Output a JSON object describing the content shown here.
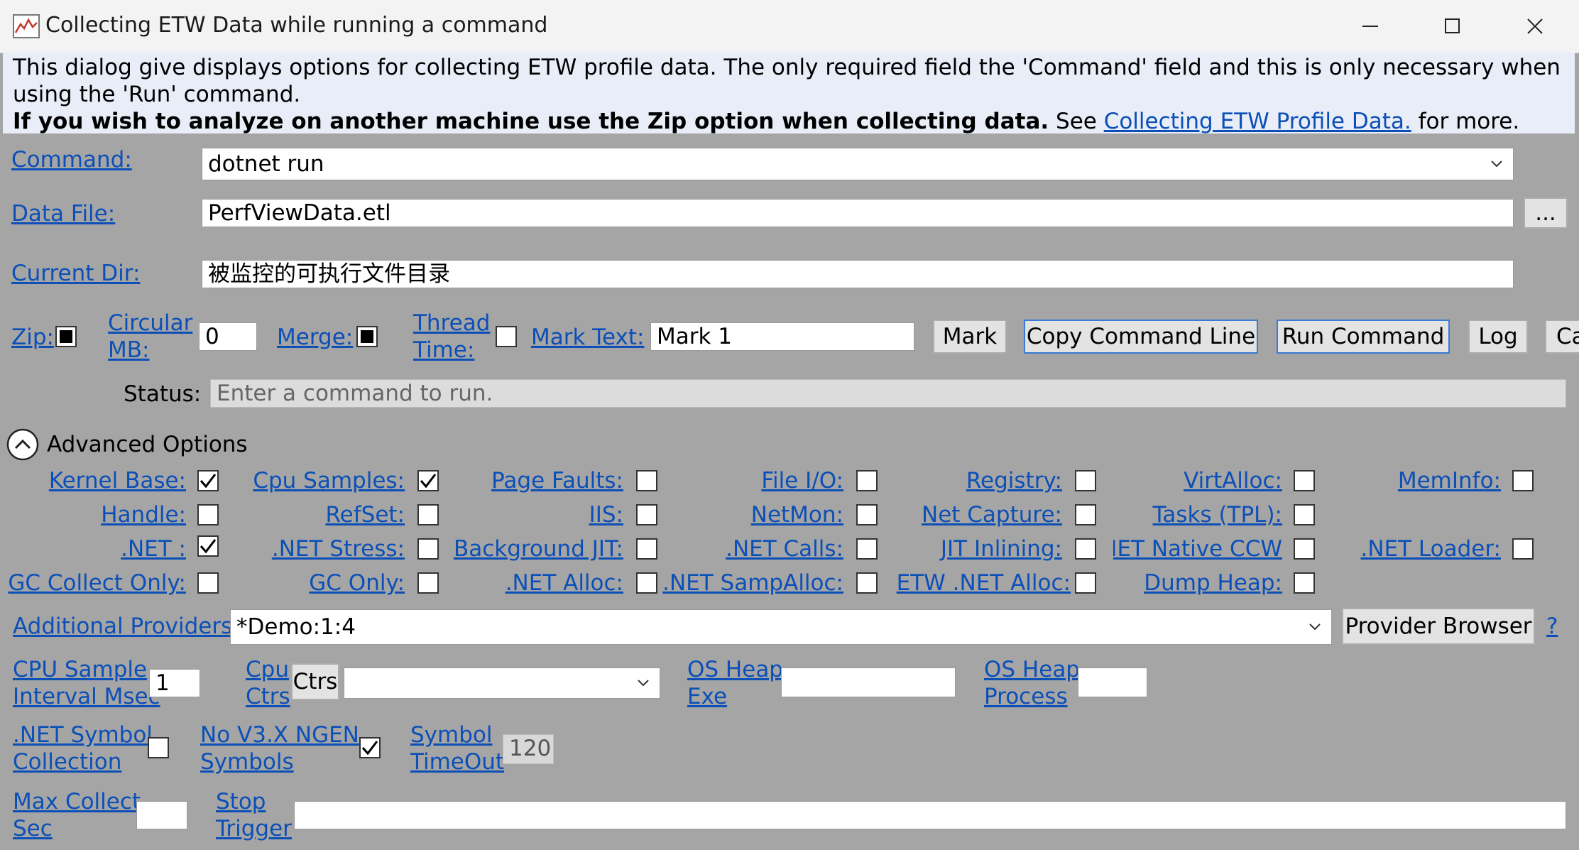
{
  "window": {
    "title": "Collecting ETW Data while running a command",
    "minimize_icon": "minimize-icon",
    "maximize_icon": "maximize-icon",
    "close_icon": "close-icon"
  },
  "info": {
    "line1": "This dialog give displays options for collecting ETW profile data. The only required field the 'Command' field and this is only necessary when using the 'Run' command.",
    "bold": "If you wish to analyze on another machine use the Zip option when collecting data.",
    "see": " See ",
    "link": "Collecting ETW Profile Data.",
    "more": " for more."
  },
  "command": {
    "label": "Command:",
    "value": "dotnet run"
  },
  "data_file": {
    "label": "Data File:",
    "value": "PerfViewData.etl",
    "browse": "..."
  },
  "current_dir": {
    "label": "Current Dir:",
    "value": "被监控的可执行文件目录"
  },
  "options_row": {
    "zip": "Zip:",
    "circular_1": "Circular",
    "circular_2": "MB:",
    "circular_value": "0",
    "merge": "Merge:",
    "thread_1": "Thread",
    "thread_2": "Time:",
    "mark_text": "Mark Text:",
    "mark_value": "Mark 1",
    "mark_btn": "Mark",
    "copy_btn": "Copy Command Line",
    "run_btn": "Run Command",
    "log_btn": "Log",
    "cancel_btn": "Ca"
  },
  "status": {
    "label": "Status:",
    "value": "Enter a command to run."
  },
  "advanced": {
    "label": "Advanced Options"
  },
  "grid": {
    "col1": [
      "Kernel Base:",
      "Handle:",
      ".NET :",
      "GC Collect Only:"
    ],
    "col2": [
      "Cpu Samples:",
      "RefSet:",
      ".NET Stress:",
      "GC Only:"
    ],
    "col3": [
      "Page Faults:",
      "IIS:",
      "Background JIT:",
      ".NET Alloc:"
    ],
    "col4": [
      "File I/O:",
      "NetMon:",
      ".NET Calls:",
      ".NET SampAlloc:"
    ],
    "col5": [
      "Registry:",
      "Net Capture:",
      "JIT Inlining:",
      "ETW .NET Alloc:"
    ],
    "col6": [
      "VirtAlloc:",
      "Tasks (TPL):",
      "NET Native CCW:",
      "Dump Heap:"
    ],
    "col7": [
      "MemInfo:",
      ".NET Loader:"
    ]
  },
  "providers": {
    "label": "Additional Providers:",
    "value": "*Demo:1:4",
    "browser_btn": "Provider Browser",
    "help": "?"
  },
  "cpu_row": {
    "sample_1": "CPU Sample",
    "sample_2": "Interval Msec",
    "sample_value": "1",
    "ctrs_1": "Cpu",
    "ctrs_2": "Ctrs",
    "ctrs_btn": "Ctrs",
    "osheap_1": "OS Heap",
    "osheap_2": "Exe",
    "osheapproc_1": "OS Heap",
    "osheapproc_2": "Process"
  },
  "symbol_row": {
    "netsym_1": ".NET Symbol",
    "netsym_2": "Collection",
    "nov3_1": "No V3.X NGEN",
    "nov3_2": "Symbols",
    "timeout_1": "Symbol",
    "timeout_2": "TimeOut",
    "timeout_value": "120"
  },
  "max_row": {
    "max_1": "Max Collect",
    "max_2": "Sec",
    "stop_1": "Stop",
    "stop_2": "Trigger"
  }
}
